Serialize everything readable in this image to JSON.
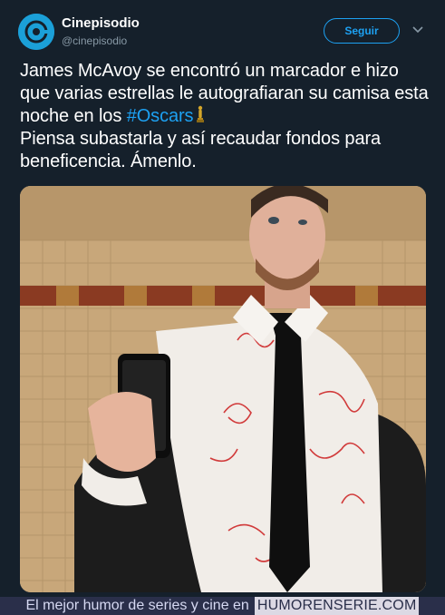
{
  "account": {
    "name": "Cinepisodio",
    "handle": "@cinepisodio",
    "avatar_icon": "film-reel-icon"
  },
  "header": {
    "follow_label": "Seguir",
    "menu_icon": "chevron-down-icon"
  },
  "tweet": {
    "text_part1": "James McAvoy se encontró un marcador e hizo que varias estrellas le autografiaran su camisa esta noche en los ",
    "hashtag": "#Oscars",
    "text_part2": "Piensa subastarla y así recaudar fondos para beneficencia. Ámenlo.",
    "emoji_icon": "trophy-icon"
  },
  "photo": {
    "subject": "mirror-selfie"
  },
  "footer": {
    "tagline": "El mejor humor de series y cine en",
    "brand": "HUMORENSERIE.COM"
  },
  "colors": {
    "background": "#15202b",
    "accent": "#1da1f2",
    "muted": "#8899a6",
    "footer_bg": "#2a2f4a"
  }
}
